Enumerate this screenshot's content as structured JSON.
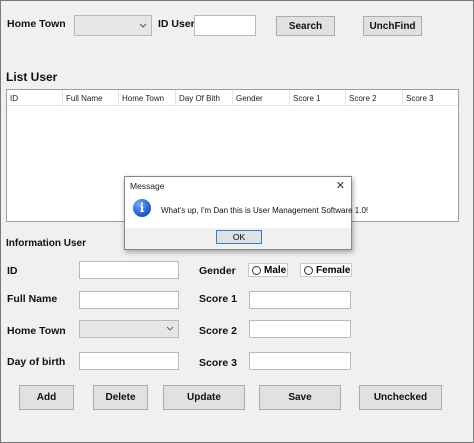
{
  "search": {
    "home_town_label": "Home Town",
    "id_user_label": "ID User",
    "search_button": "Search",
    "unchfind_button": "UnchFind"
  },
  "list": {
    "title": "List User",
    "columns": [
      "ID",
      "Full Name",
      "Home Town",
      "Day Of Bith",
      "Gender",
      "Score 1",
      "Score 2",
      "Score 3"
    ]
  },
  "info": {
    "title": "Information User",
    "id_label": "ID",
    "full_name_label": "Full Name",
    "home_town_label": "Home Town",
    "day_of_birth_label": "Day of birth",
    "gender_label": "Gender",
    "male_label": "Male",
    "female_label": "Female",
    "score1_label": "Score 1",
    "score2_label": "Score 2",
    "score3_label": "Score 3"
  },
  "actions": {
    "add": "Add",
    "delete": "Delete",
    "update": "Update",
    "save": "Save",
    "unchecked": "Unchecked"
  },
  "dialog": {
    "title": "Message",
    "close": "✕",
    "icon": "info-icon",
    "icon_glyph": "i",
    "message": "What's up, I'm Dan this is User Management Software 1.0!",
    "ok": "OK"
  }
}
